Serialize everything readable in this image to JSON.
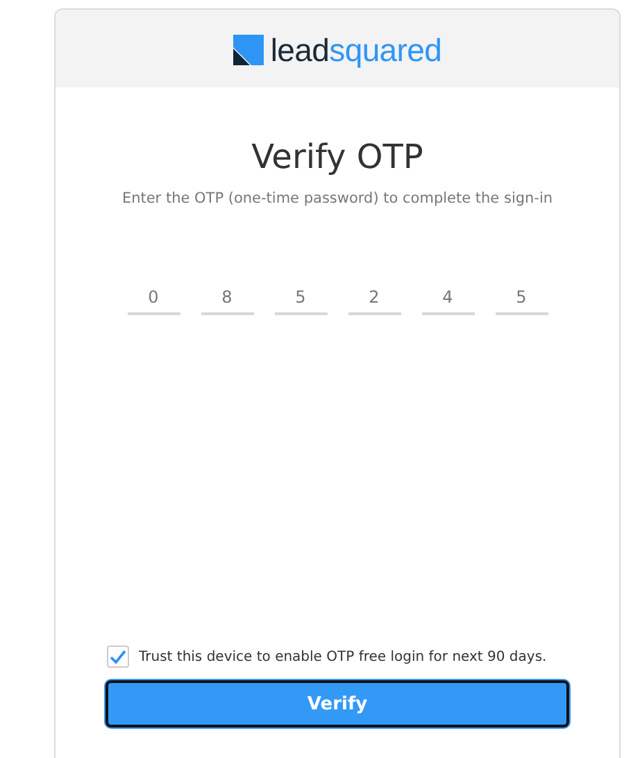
{
  "logo": {
    "words": [
      "lead",
      "squared"
    ]
  },
  "title": "Verify OTP",
  "subtitle": "Enter the OTP (one-time password) to complete the sign-in",
  "otp_digits": [
    "0",
    "8",
    "5",
    "2",
    "4",
    "5"
  ],
  "trust_device": {
    "label": "Trust this device to enable OTP free login for next 90 days.",
    "checked": true
  },
  "verify_button": {
    "label": "Verify",
    "focused": true
  }
}
